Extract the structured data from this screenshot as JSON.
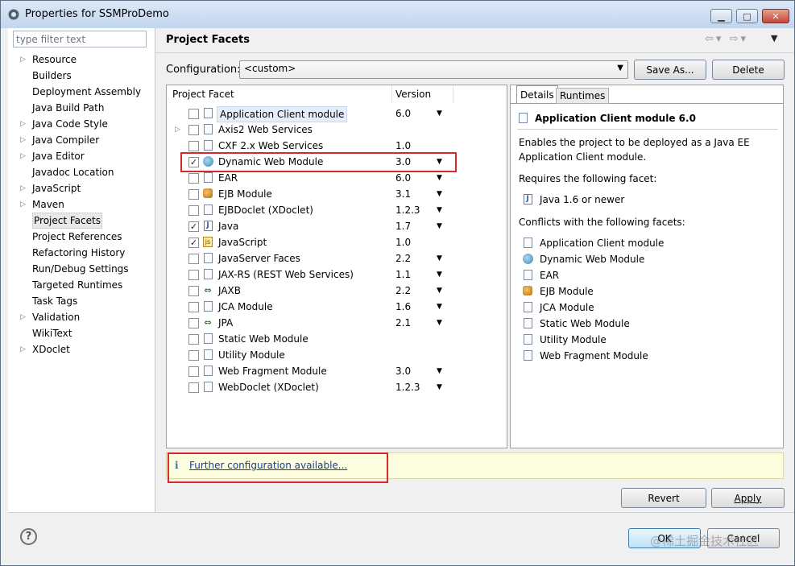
{
  "window": {
    "title": "Properties for SSMProDemo"
  },
  "filter": {
    "placeholder": "type filter text"
  },
  "sidebar": {
    "items": [
      {
        "label": "Resource",
        "expandable": true
      },
      {
        "label": "Builders",
        "expandable": false
      },
      {
        "label": "Deployment Assembly",
        "expandable": false
      },
      {
        "label": "Java Build Path",
        "expandable": false
      },
      {
        "label": "Java Code Style",
        "expandable": true
      },
      {
        "label": "Java Compiler",
        "expandable": true
      },
      {
        "label": "Java Editor",
        "expandable": true
      },
      {
        "label": "Javadoc Location",
        "expandable": false
      },
      {
        "label": "JavaScript",
        "expandable": true
      },
      {
        "label": "Maven",
        "expandable": true
      },
      {
        "label": "Project Facets",
        "expandable": false,
        "selected": true
      },
      {
        "label": "Project References",
        "expandable": false
      },
      {
        "label": "Refactoring History",
        "expandable": false
      },
      {
        "label": "Run/Debug Settings",
        "expandable": false
      },
      {
        "label": "Targeted Runtimes",
        "expandable": false
      },
      {
        "label": "Task Tags",
        "expandable": false
      },
      {
        "label": "Validation",
        "expandable": true
      },
      {
        "label": "WikiText",
        "expandable": false
      },
      {
        "label": "XDoclet",
        "expandable": true
      }
    ]
  },
  "page": {
    "title": "Project Facets"
  },
  "config": {
    "label": "Configuration:",
    "value": "<custom>",
    "save_as": "Save As...",
    "delete": "Delete"
  },
  "facets": {
    "header_facet": "Project Facet",
    "header_version": "Version",
    "rows": [
      {
        "name": "Application Client module",
        "version": "6.0",
        "checked": false,
        "dropdown": true,
        "icon": "doc-icon",
        "selected": true
      },
      {
        "name": "Axis2 Web Services",
        "version": "",
        "checked": false,
        "dropdown": false,
        "icon": "doc-icon",
        "expandable": true
      },
      {
        "name": "CXF 2.x Web Services",
        "version": "1.0",
        "checked": false,
        "dropdown": false,
        "icon": "doc-icon"
      },
      {
        "name": "Dynamic Web Module",
        "version": "3.0",
        "checked": true,
        "dropdown": true,
        "icon": "globe-icon"
      },
      {
        "name": "EAR",
        "version": "6.0",
        "checked": false,
        "dropdown": true,
        "icon": "doc-icon"
      },
      {
        "name": "EJB Module",
        "version": "3.1",
        "checked": false,
        "dropdown": true,
        "icon": "bean-icon"
      },
      {
        "name": "EJBDoclet (XDoclet)",
        "version": "1.2.3",
        "checked": false,
        "dropdown": true,
        "icon": "doc-icon"
      },
      {
        "name": "Java",
        "version": "1.7",
        "checked": true,
        "dropdown": true,
        "icon": "java-icon"
      },
      {
        "name": "JavaScript",
        "version": "1.0",
        "checked": true,
        "dropdown": false,
        "icon": "js-icon"
      },
      {
        "name": "JavaServer Faces",
        "version": "2.2",
        "checked": false,
        "dropdown": true,
        "icon": "doc-icon"
      },
      {
        "name": "JAX-RS (REST Web Services)",
        "version": "1.1",
        "checked": false,
        "dropdown": true,
        "icon": "doc-icon"
      },
      {
        "name": "JAXB",
        "version": "2.2",
        "checked": false,
        "dropdown": true,
        "icon": "arrows-icon"
      },
      {
        "name": "JCA Module",
        "version": "1.6",
        "checked": false,
        "dropdown": true,
        "icon": "doc-icon"
      },
      {
        "name": "JPA",
        "version": "2.1",
        "checked": false,
        "dropdown": true,
        "icon": "arrows-icon"
      },
      {
        "name": "Static Web Module",
        "version": "",
        "checked": false,
        "dropdown": false,
        "icon": "doc-icon"
      },
      {
        "name": "Utility Module",
        "version": "",
        "checked": false,
        "dropdown": false,
        "icon": "doc-icon"
      },
      {
        "name": "Web Fragment Module",
        "version": "3.0",
        "checked": false,
        "dropdown": true,
        "icon": "doc-icon"
      },
      {
        "name": "WebDoclet (XDoclet)",
        "version": "1.2.3",
        "checked": false,
        "dropdown": true,
        "icon": "doc-icon"
      }
    ]
  },
  "details": {
    "tab_details": "Details",
    "tab_runtimes": "Runtimes",
    "heading": "Application Client module 6.0",
    "desc_line1": "Enables the project to be deployed as a Java EE",
    "desc_line2": "Application Client module.",
    "requires_label": "Requires the following facet:",
    "requires": [
      {
        "label": "Java 1.6 or newer",
        "icon": "java-icon"
      }
    ],
    "conflicts_label": "Conflicts with the following facets:",
    "conflicts": [
      {
        "label": "Application Client module",
        "icon": "doc-icon"
      },
      {
        "label": "Dynamic Web Module",
        "icon": "globe-icon"
      },
      {
        "label": "EAR",
        "icon": "doc-icon"
      },
      {
        "label": "EJB Module",
        "icon": "bean-icon"
      },
      {
        "label": "JCA Module",
        "icon": "doc-icon"
      },
      {
        "label": "Static Web Module",
        "icon": "doc-icon"
      },
      {
        "label": "Utility Module",
        "icon": "doc-icon"
      },
      {
        "label": "Web Fragment Module",
        "icon": "doc-icon"
      }
    ]
  },
  "info": {
    "icon": "i",
    "link": "Further configuration available..."
  },
  "buttons": {
    "revert": "Revert",
    "apply": "Apply",
    "ok": "OK",
    "cancel": "Cancel"
  },
  "help": {
    "icon": "?"
  },
  "watermark": "@稀土掘金技术社区",
  "colors": {
    "highlight_box": "#d42a2a",
    "info_bg": "#fdfde0",
    "link": "#1b3e8a"
  }
}
